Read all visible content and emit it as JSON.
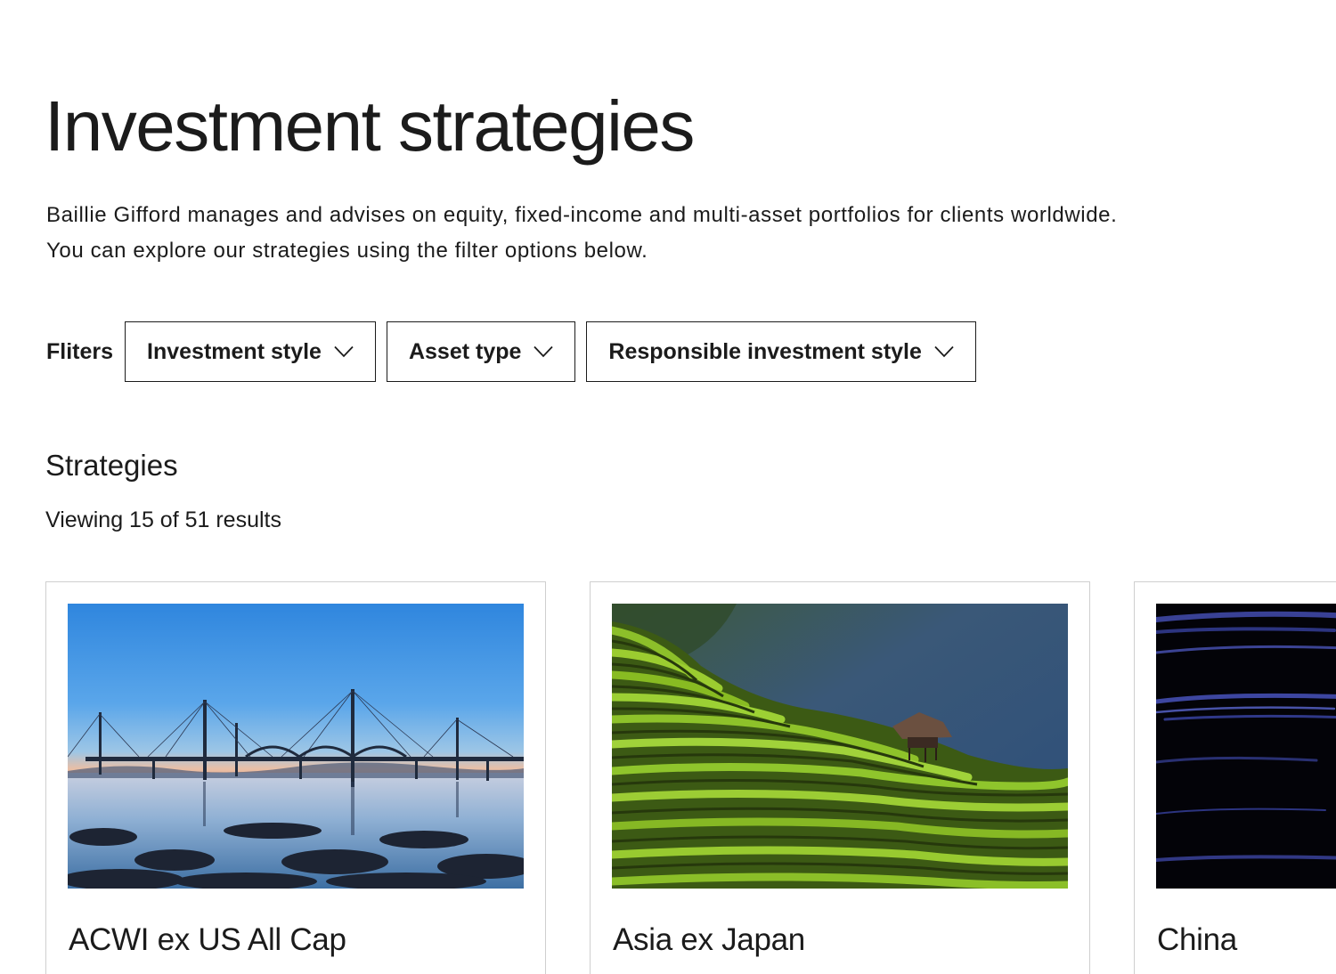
{
  "page": {
    "title": "Investment strategies",
    "intro_line1": "Baillie Gifford manages and advises on equity, fixed-income and multi-asset portfolios for clients worldwide.",
    "intro_line2": "You can explore our strategies using the filter options below."
  },
  "filters": {
    "label": "Fliters",
    "options": [
      {
        "label": "Investment style",
        "icon": "chevron-down-icon"
      },
      {
        "label": "Asset type",
        "icon": "chevron-down-icon"
      },
      {
        "label": "Responsible investment style",
        "icon": "chevron-down-icon"
      }
    ]
  },
  "strategies": {
    "heading": "Strategies",
    "results_text": "Viewing 15 of 51 results",
    "cards": [
      {
        "title": "ACWI ex US All Cap",
        "image": "bridges-at-dusk-photo"
      },
      {
        "title": "Asia ex Japan",
        "image": "rice-terraces-photo"
      },
      {
        "title": "China",
        "image": "dark-blue-brushstrokes-image"
      }
    ]
  },
  "colors": {
    "text": "#1b1b1b",
    "border": "#1b1b1b",
    "card_border": "#cfcfcf",
    "background": "#ffffff"
  }
}
